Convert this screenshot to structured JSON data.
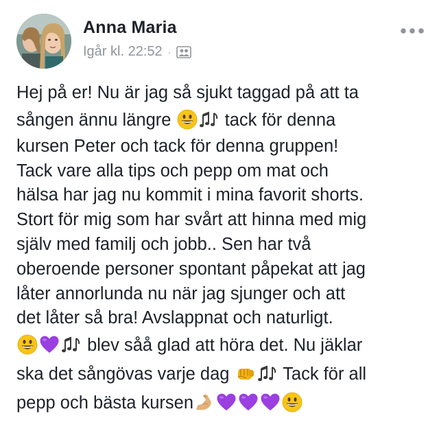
{
  "post": {
    "author": {
      "name": "Anna Maria"
    },
    "timestamp": "Igår kl. 22:52",
    "separator": "·",
    "audience_icon": "friends-icon",
    "more_icon": "more-horizontal-icon",
    "text_segments": {
      "l1": "Hej på er! Nu är jag så sjukt taggad på att ta",
      "l2a": "sången ännu längre ",
      "l2b": " tack för denna",
      "l3": "kursen Peter och tack för denna gruppen!",
      "l4": "Tack vare alla tips och pepp om mat och",
      "l5": "hälsa har jag nu kommit i mina favorit shorts.",
      "l6": "Stort för mig som har svårt att hinna med mig",
      "l7": "själv med familj och jobb.. Sen har två",
      "l8": "oberoende personer spontant påpekat att jag",
      "l9": "låter annorlunda nu när jag sjunger och att",
      "l10": "det låter så bra! Avslappnat och naturligt.",
      "l11b": " blev såå glad att höra det. Nu jäklar",
      "l12a": "ska det sångövas varje dag ",
      "l12b": " Tack för all",
      "l13a": "pepp och bästa kursen"
    },
    "emojis": [
      "grinning-face-emoji",
      "musical-notes-emoji",
      "purple-heart-emoji",
      "oncoming-fist-emoji",
      "flexed-biceps-emoji"
    ],
    "colors": {
      "text": "#1d2129",
      "meta": "#90949c",
      "emoji_yellow": "#f7c51a",
      "heart_purple": "#9b3fe0"
    }
  }
}
